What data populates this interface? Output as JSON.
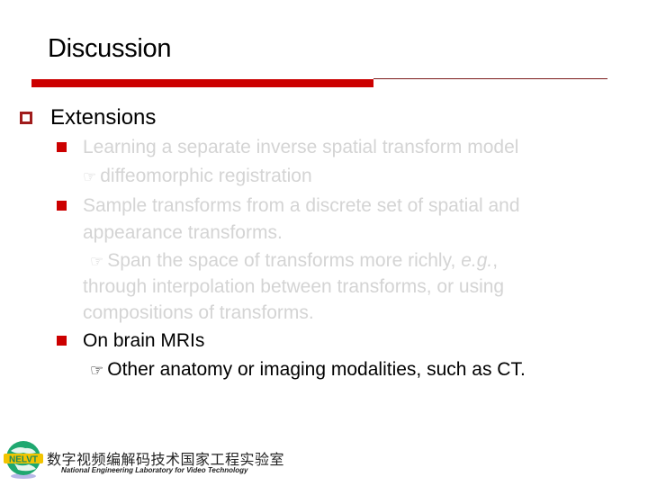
{
  "slide": {
    "title": "Discussion",
    "section": {
      "label": "Extensions",
      "items": [
        {
          "text": "Learning a separate inverse spatial transform model",
          "sub": "diffeomorphic registration",
          "dimmed": true
        },
        {
          "text_line1": "Sample transforms from a discrete set of spatial and",
          "text_line2": "appearance transforms.",
          "sub_pre": "Span the space of transforms more richly, ",
          "sub_italic": "e.g.",
          "sub_post": ",",
          "sub_line2": "through interpolation between transforms, or using",
          "sub_line3": "compositions of transforms.",
          "dimmed": true
        },
        {
          "text": "On brain MRIs",
          "sub": "Other anatomy or imaging modalities, such as CT.",
          "dimmed": false
        }
      ]
    },
    "hand_icon": "☞"
  },
  "footer": {
    "logo_text": "NELVT",
    "org_cn": "数字视频编解码技术国家工程实验室",
    "org_en": "National Engineering Laboratory for Video Technology"
  },
  "colors": {
    "accent_red": "#cc0000",
    "dark_red": "#a01c1c",
    "dimmed_text": "#d4d4d4"
  }
}
